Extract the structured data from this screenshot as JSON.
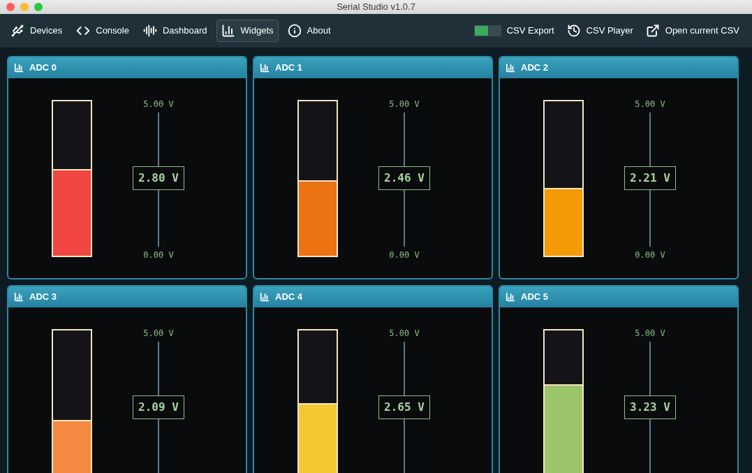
{
  "window": {
    "title": "Serial Studio v1.0.7"
  },
  "toolbar": {
    "tabs": [
      {
        "label": "Devices",
        "selected": false
      },
      {
        "label": "Console",
        "selected": false
      },
      {
        "label": "Dashboard",
        "selected": false
      },
      {
        "label": "Widgets",
        "selected": true
      },
      {
        "label": "About",
        "selected": false
      }
    ],
    "csv_export": {
      "label": "CSV Export",
      "on": true
    },
    "actions": [
      {
        "label": "CSV Player"
      },
      {
        "label": "Open current CSV"
      }
    ]
  },
  "widgets": [
    {
      "title": "ADC 0",
      "max_label": "5.00 V",
      "min_label": "0.00 V",
      "reading": "2.80 V",
      "level": 0.56,
      "color": "#f04541"
    },
    {
      "title": "ADC 1",
      "max_label": "5.00 V",
      "min_label": "0.00 V",
      "reading": "2.46 V",
      "level": 0.49,
      "color": "#ec7212"
    },
    {
      "title": "ADC 2",
      "max_label": "5.00 V",
      "min_label": "0.00 V",
      "reading": "2.21 V",
      "level": 0.44,
      "color": "#f39a05"
    },
    {
      "title": "ADC 3",
      "max_label": "5.00 V",
      "reading": "2.09 V",
      "level": 0.42,
      "color": "#f48a42"
    },
    {
      "title": "ADC 4",
      "max_label": "5.00 V",
      "reading": "2.65 V",
      "level": 0.53,
      "color": "#f4c832"
    },
    {
      "title": "ADC 5",
      "max_label": "5.00 V",
      "reading": "3.23 V",
      "level": 0.65,
      "color": "#9cc46a"
    }
  ]
}
